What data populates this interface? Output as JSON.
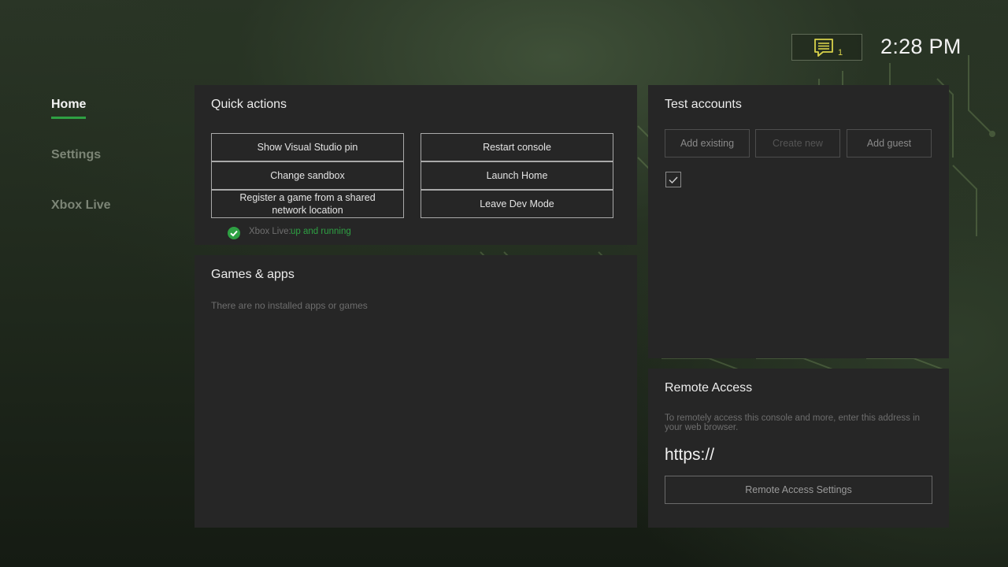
{
  "header": {
    "notification_count": "1",
    "clock": "2:28 PM"
  },
  "nav": {
    "items": [
      {
        "label": "Home"
      },
      {
        "label": "Settings"
      },
      {
        "label": "Xbox Live"
      }
    ]
  },
  "quick_actions": {
    "title": "Quick actions",
    "buttons_left": [
      "Show Visual Studio pin",
      "Change sandbox",
      "Register a game from a shared network location"
    ],
    "buttons_right": [
      "Restart console",
      "Launch Home",
      "Leave Dev Mode"
    ],
    "xbox_live_prefix": "Xbox Live:",
    "xbox_live_status": "up and running"
  },
  "games_apps": {
    "title": "Games & apps",
    "empty_text": "There are no installed apps or games"
  },
  "test_accounts": {
    "title": "Test accounts",
    "buttons": [
      "Add existing",
      "Create new",
      "Add guest"
    ]
  },
  "remote_access": {
    "title": "Remote Access",
    "description": "To remotely access this console and more, enter this address in your web browser.",
    "url": "https://",
    "settings_button": "Remote Access Settings"
  },
  "colors": {
    "accent_green": "#2ea043",
    "notification_yellow": "#d8d24a"
  }
}
